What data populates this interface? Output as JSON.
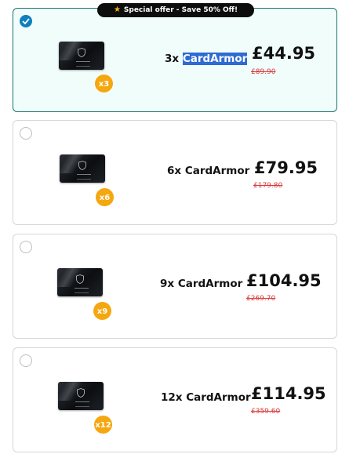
{
  "offer_banner": {
    "text": "Special offer - Save 50% Off!",
    "icon": "star-icon"
  },
  "options": [
    {
      "qty_prefix": "3x",
      "product": "CardArmor",
      "price": "£44.95",
      "old_price": "£89.90",
      "badge": "x3",
      "selected": true
    },
    {
      "qty_prefix": "6x",
      "product": "CardArmor",
      "price": "£79.95",
      "old_price": "£179.80",
      "badge": "x6",
      "selected": false
    },
    {
      "qty_prefix": "9x",
      "product": "CardArmor",
      "price": "£104.95",
      "old_price": "£269.70",
      "badge": "x9",
      "selected": false
    },
    {
      "qty_prefix": "12x",
      "product": "CardArmor",
      "price": "£114.95",
      "old_price": "£359.60",
      "badge": "x12",
      "selected": false
    }
  ],
  "colors": {
    "accent": "#0f7fbd",
    "badge": "#f5a70f",
    "old_price": "#d93b3b",
    "selected_bg": "#f0fdfb",
    "selected_border": "#16766e"
  }
}
